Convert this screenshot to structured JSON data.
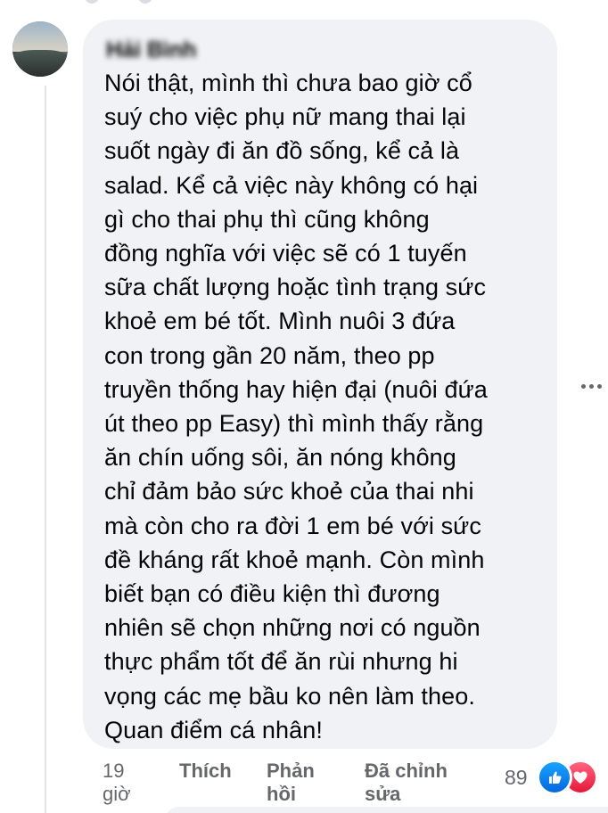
{
  "comment": {
    "author_name": "Hải Bình",
    "text": "Nói thật, mình thì chưa bao giờ cổ\nsuý cho việc phụ nữ mang thai lại\nsuốt ngày đi ăn đồ sống, kể cả là\nsalad. Kể cả việc này không có hại\ngì cho thai phụ thì cũng không\nđồng nghĩa với việc sẽ có 1 tuyến\nsữa chất lượng hoặc tình trạng sức\nkhoẻ em bé tốt. Mình nuôi 3 đứa\ncon trong gần 20 năm, theo pp\ntruyền thống hay hiện đại (nuôi đứa\nút theo pp Easy) thì mình thấy rằng\năn chín uống sôi, ăn nóng không\nchỉ đảm bảo sức khoẻ của thai nhi\nmà còn cho ra đời 1 em bé với sức\nđề kháng rất khoẻ mạnh. Còn mình\nbiết bạn có điều kiện thì đương\nnhiên sẽ chọn những nơi có nguồn\nthực phẩm tốt để ăn rùi nhưng hi\nvọng các mẹ bầu ko nên làm theo.\nQuan điểm cá nhân!"
  },
  "actions": {
    "time": "19\ngiờ",
    "like": "Thích",
    "reply": "Phản\nhồi",
    "edited": "Đã chỉnh\nsửa"
  },
  "reactions": {
    "count": "89",
    "icons": [
      "like-icon",
      "love-icon"
    ],
    "like_color": "#0866ff",
    "love_color": "#f33e58"
  },
  "colors": {
    "bubble": "#f0f2f5",
    "text": "#050505",
    "secondary": "#65676b"
  }
}
